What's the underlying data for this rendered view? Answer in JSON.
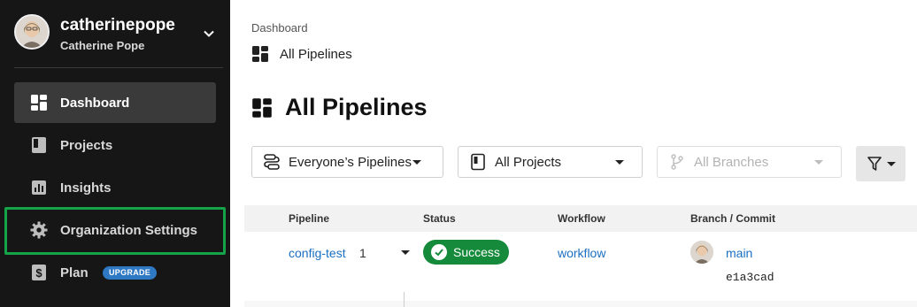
{
  "user": {
    "username": "catherinepope",
    "full_name": "Catherine Pope"
  },
  "sidebar": {
    "items": [
      {
        "label": "Dashboard",
        "icon": "dashboard-icon",
        "active": true
      },
      {
        "label": "Projects",
        "icon": "projects-icon"
      },
      {
        "label": "Insights",
        "icon": "insights-icon"
      },
      {
        "label": "Organization Settings",
        "icon": "gear-icon",
        "focused": true
      },
      {
        "label": "Plan",
        "icon": "dollar-icon",
        "badge": "UPGRADE"
      }
    ]
  },
  "breadcrumb": {
    "root": "Dashboard",
    "current": "All Pipelines"
  },
  "page_title": "All Pipelines",
  "filters": {
    "pipelines": "Everyone’s Pipelines",
    "projects": "All Projects",
    "branches": "All Branches"
  },
  "table": {
    "headers": [
      "Pipeline",
      "Status",
      "Workflow",
      "Branch / Commit"
    ],
    "rows": [
      {
        "pipeline": "config-test",
        "number": "1",
        "status": "Success",
        "workflow": "workflow",
        "branch": "main",
        "commit": "e1a3cad"
      }
    ]
  },
  "colors": {
    "sidebar_bg": "#161616",
    "success": "#158a3a",
    "link": "#1c6fc1",
    "focus": "#15a34a"
  }
}
